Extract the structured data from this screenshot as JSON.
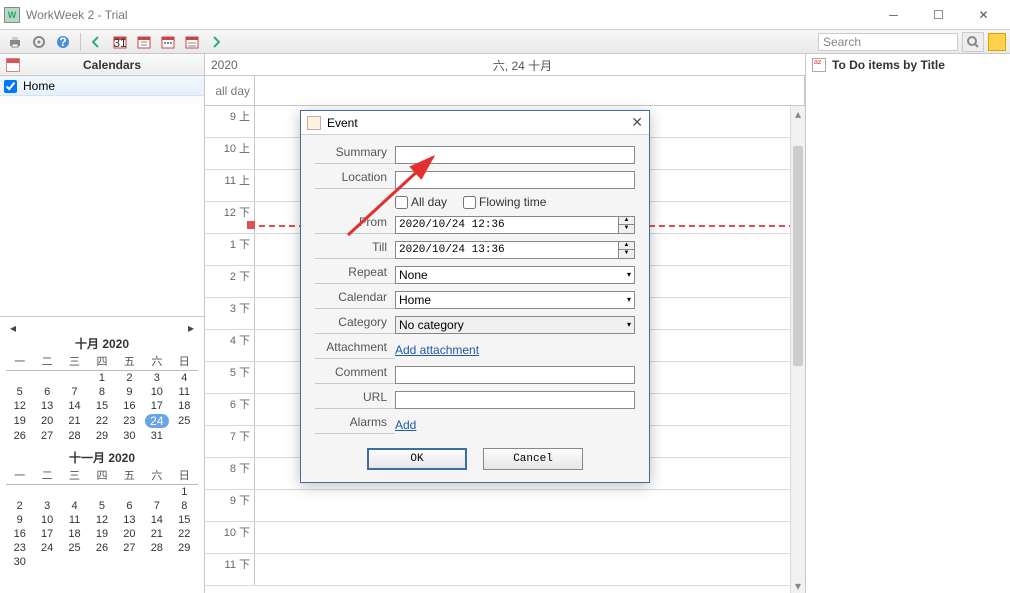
{
  "window": {
    "title": "WorkWeek 2 - Trial"
  },
  "toolbar": {
    "search_placeholder": "Search"
  },
  "left": {
    "panel_title": "Calendars",
    "calendars": [
      {
        "name": "Home",
        "checked": true
      }
    ],
    "month1": {
      "title": "十月 2020",
      "dow": [
        "一",
        "二",
        "三",
        "四",
        "五",
        "六",
        "日"
      ],
      "weeks": [
        [
          "",
          "",
          "",
          "1",
          "2",
          "3",
          "4"
        ],
        [
          "5",
          "6",
          "7",
          "8",
          "9",
          "10",
          "11"
        ],
        [
          "12",
          "13",
          "14",
          "15",
          "16",
          "17",
          "18"
        ],
        [
          "19",
          "20",
          "21",
          "22",
          "23",
          "24",
          "25"
        ],
        [
          "26",
          "27",
          "28",
          "29",
          "30",
          "31",
          ""
        ]
      ],
      "today": "24"
    },
    "month2": {
      "title": "十一月 2020",
      "dow": [
        "一",
        "二",
        "三",
        "四",
        "五",
        "六",
        "日"
      ],
      "weeks": [
        [
          "",
          "",
          "",
          "",
          "",
          "",
          "1"
        ],
        [
          "2",
          "3",
          "4",
          "5",
          "6",
          "7",
          "8"
        ],
        [
          "9",
          "10",
          "11",
          "12",
          "13",
          "14",
          "15"
        ],
        [
          "16",
          "17",
          "18",
          "19",
          "20",
          "21",
          "22"
        ],
        [
          "23",
          "24",
          "25",
          "26",
          "27",
          "28",
          "29"
        ],
        [
          "30",
          "",
          "",
          "",
          "",
          "",
          ""
        ]
      ]
    }
  },
  "center": {
    "year": "2020",
    "day_title": "六, 24 十月",
    "all_day_label": "all day",
    "hours": [
      "9 上",
      "10 上",
      "11 上",
      "12 下",
      "1 下",
      "2 下",
      "3 下",
      "4 下",
      "5 下",
      "6 下",
      "7 下",
      "8 下",
      "9 下",
      "10 下",
      "11 下"
    ]
  },
  "right": {
    "title": "To Do items  by Title"
  },
  "dialog": {
    "title": "Event",
    "labels": {
      "summary": "Summary",
      "location": "Location",
      "from": "From",
      "till": "Till",
      "repeat": "Repeat",
      "calendar": "Calendar",
      "category": "Category",
      "attachment": "Attachment",
      "comment": "Comment",
      "url": "URL",
      "alarms": "Alarms"
    },
    "checks": {
      "all_day": "All day",
      "flowing": "Flowing time"
    },
    "from_value": "2020/10/24 12:36",
    "till_value": "2020/10/24 13:36",
    "repeat_value": "None",
    "calendar_value": "Home",
    "category_value": "No category",
    "attachment_link": "Add attachment",
    "alarms_link": "Add",
    "ok": "OK",
    "cancel": "Cancel"
  }
}
